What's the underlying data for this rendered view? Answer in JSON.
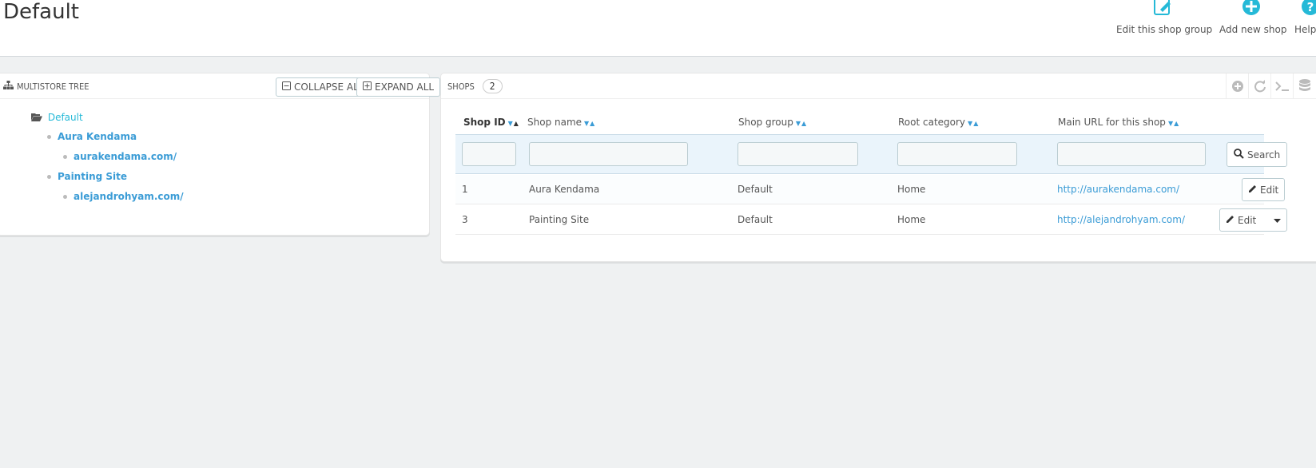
{
  "header": {
    "title": "Default",
    "actions": [
      {
        "label": "Edit this shop group",
        "icon": "edit-icon"
      },
      {
        "label": "Add new shop",
        "icon": "plus-circle-icon"
      },
      {
        "label": "Help",
        "icon": "help-circle-icon"
      }
    ]
  },
  "tree_panel": {
    "title": "MULTISTORE TREE",
    "collapse_label": "Collapse All",
    "expand_label": "Expand All",
    "root": "Default",
    "shops": [
      {
        "name": "Aura Kendama",
        "url": "aurakendama.com/"
      },
      {
        "name": "Painting Site",
        "url": "alejandrohyam.com/"
      }
    ]
  },
  "shops_panel": {
    "title": "SHOPS",
    "count": "2",
    "columns": [
      "Shop ID",
      "Shop name",
      "Shop group",
      "Root category",
      "Main URL for this shop"
    ],
    "search_label": "Search",
    "rows": [
      {
        "id": "1",
        "name": "Aura Kendama",
        "group": "Default",
        "category": "Home",
        "url": "http://aurakendama.com/",
        "action": "Edit"
      },
      {
        "id": "3",
        "name": "Painting Site",
        "group": "Default",
        "category": "Home",
        "url": "http://alejandrohyam.com/",
        "action": "Edit"
      }
    ]
  },
  "colors": {
    "accent": "#25b9d7",
    "link": "#3b9cd6",
    "background": "#eff1f2"
  }
}
